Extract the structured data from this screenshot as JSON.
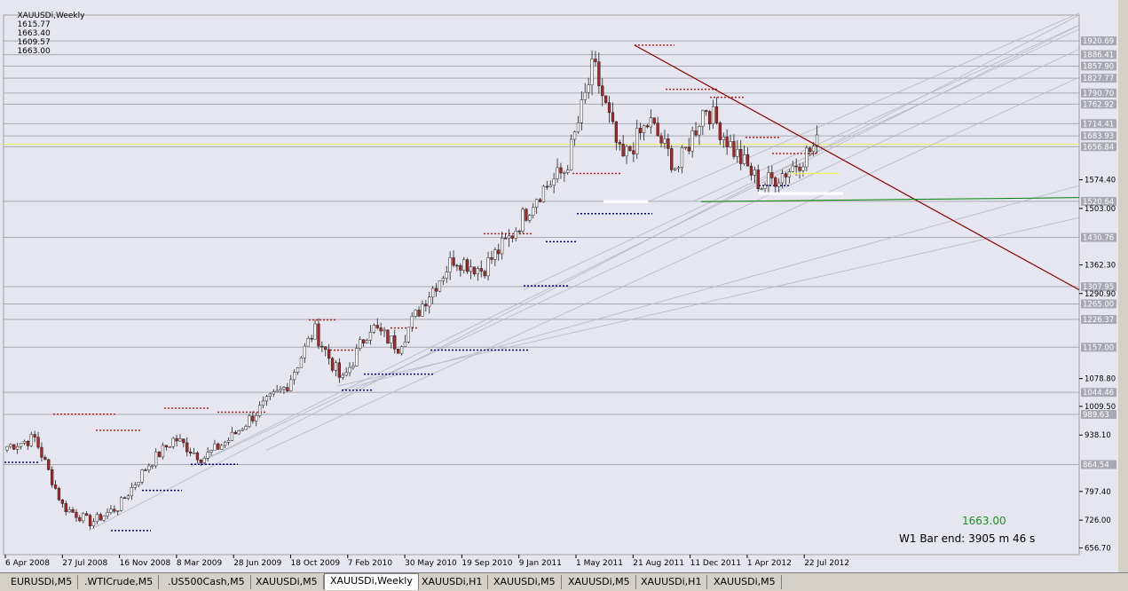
{
  "header": {
    "symbol": "XAUUSDi,Weekly",
    "open": "1615.77",
    "high": "1663.40",
    "low": "1609.57",
    "close": "1663.00"
  },
  "overlay": {
    "current_price": "1663.00",
    "bar_end": "W1 Bar end: 3905 m 46 s"
  },
  "tabs": [
    {
      "label": "EURUSDi,M5",
      "active": false
    },
    {
      "label": ".WTICrude,M5",
      "active": false
    },
    {
      "label": ".US500Cash,M5",
      "active": false
    },
    {
      "label": "XAUUSDi,M5",
      "active": false
    },
    {
      "label": "XAUUSDi,Weekly",
      "active": true
    },
    {
      "label": "XAUUSDi,H1",
      "active": false
    },
    {
      "label": "XAUUSDi,M5",
      "active": false
    },
    {
      "label": "XAUUSDi,M5",
      "active": false
    },
    {
      "label": "XAUUSDi,H1",
      "active": false
    },
    {
      "label": "XAUUSDi,M5",
      "active": false
    }
  ],
  "colors": {
    "background": "#e6e6f0",
    "bull_candle": "#ffffff",
    "bear_candle": "#b22222",
    "trendline": "#8b0000",
    "green_line": "#008000",
    "yellow_line": "#f0f070"
  },
  "chart_data": {
    "type": "candlestick",
    "symbol": "XAUUSDi",
    "timeframe": "Weekly",
    "x_ticks": [
      "6 Apr 2008",
      "27 Jul 2008",
      "16 Nov 2008",
      "8 Mar 2009",
      "28 Jun 2009",
      "18 Oct 2009",
      "7 Feb 2010",
      "30 May 2010",
      "19 Sep 2010",
      "9 Jan 2011",
      "1 May 2011",
      "21 Aug 2011",
      "11 Dec 2011",
      "1 Apr 2012",
      "22 Jul 2012"
    ],
    "y_ticks": [
      1574.4,
      1503.0,
      1362.3,
      1290.9,
      1078.8,
      1009.5,
      938.1,
      797.4,
      726.0,
      656.7
    ],
    "level_labels": [
      "1920.69",
      "1886.41",
      "1857.90",
      "1827.77",
      "1790.70",
      "1762.92",
      "1714.41",
      "1683.93",
      "1656.84",
      "1520.64",
      "1430.76",
      "1307.95",
      "1265.00",
      "1226.37",
      "1157.00",
      "1044.46",
      "989.63",
      "864.54"
    ],
    "y_range": [
      640,
      1985
    ],
    "grid": false,
    "close_path": [
      [
        "6 Apr 2008",
        910
      ],
      [
        "27 Jul 2008",
        930
      ],
      [
        "Sep 2008",
        760
      ],
      [
        "Oct 2008",
        720
      ],
      [
        "16 Nov 2008",
        760
      ],
      [
        "Jan 2009",
        860
      ],
      [
        "8 Mar 2009",
        930
      ],
      [
        "Apr 2009",
        880
      ],
      [
        "28 Jun 2009",
        930
      ],
      [
        "Sep 2009",
        1000
      ],
      [
        "18 Oct 2009",
        1060
      ],
      [
        "Dec 2009",
        1200
      ],
      [
        "7 Feb 2010",
        1070
      ],
      [
        "30 May 2010",
        1210
      ],
      [
        "Jul 2010",
        1160
      ],
      [
        "19 Sep 2010",
        1280
      ],
      [
        "Nov 2010",
        1380
      ],
      [
        "9 Jan 2011",
        1350
      ],
      [
        "Mar 2011",
        1430
      ],
      [
        "1 May 2011",
        1540
      ],
      [
        "Jul 2011",
        1600
      ],
      [
        "21 Aug 2011",
        1860
      ],
      [
        "Sep 2011",
        1620
      ],
      [
        "Oct 2011",
        1720
      ],
      [
        "11 Dec 2011",
        1600
      ],
      [
        "Feb 2012",
        1760
      ],
      [
        "1 Apr 2012",
        1650
      ],
      [
        "May 2012",
        1560
      ],
      [
        "22 Jul 2012",
        1600
      ],
      [
        "Aug 2012",
        1663
      ]
    ]
  }
}
